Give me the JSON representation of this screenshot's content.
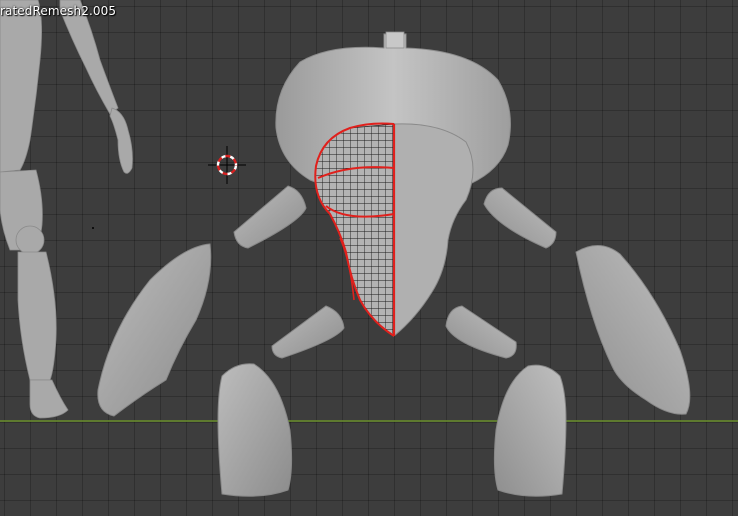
{
  "viewport": {
    "object_name": "ratedRemesh2.005",
    "background_color": "#3d3d3d",
    "grid_color": "#2f2f2f",
    "floor_axis_color": "#6a8f2b",
    "mesh_color": "#b7b7b7",
    "seam_color": "#e0201c",
    "wire_color": "#111111"
  },
  "icons": {
    "cursor": "3d-cursor-icon"
  }
}
